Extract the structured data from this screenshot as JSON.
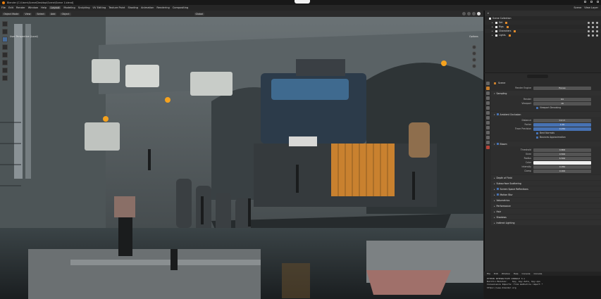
{
  "window": {
    "title": "Blender [C:\\Users\\Scene\\Desktop\\Scene\\Scene 1.blend]"
  },
  "menubar": {
    "items": [
      "File",
      "Edit",
      "Render",
      "Window",
      "Help",
      "Layout",
      "Modeling",
      "Sculpting",
      "UV Editing",
      "Texture Paint",
      "Shading",
      "Animation",
      "Rendering",
      "Compositing"
    ],
    "active": "Layout",
    "scene_label": "Scene",
    "view_layer_label": "View Layer"
  },
  "viewport_header": {
    "mode": "Object Mode",
    "view": "View",
    "select": "Select",
    "add": "Add",
    "object": "Object",
    "orientation": "Global",
    "options": "Options"
  },
  "viewport": {
    "overlay_left": "User Perspective (Local)",
    "overlay_right": "Options"
  },
  "outliner": {
    "rows": [
      {
        "label": "Scene Collection",
        "indent": 0
      },
      {
        "label": "Set",
        "indent": 1
      },
      {
        "label": "Rigs",
        "indent": 1
      },
      {
        "label": "Characters",
        "indent": 1
      },
      {
        "label": "Lights",
        "indent": 1
      }
    ]
  },
  "properties": {
    "header": "Scene",
    "render_engine_label": "Render Engine",
    "render_engine_value": "Eevee",
    "sampling_title": "Sampling",
    "render_label": "Render",
    "render_value": "64",
    "viewport_label": "Viewport",
    "viewport_value": "16",
    "viewport_denoising": "Viewport Denoising",
    "ao_title": "Ambient Occlusion",
    "distance_label": "Distance",
    "distance_value": "0.2 m",
    "factor_label": "Factor",
    "factor_value": "1.00",
    "trace_precision_label": "Trace Precision",
    "trace_precision_value": "0.250",
    "bent_normals": "Bent Normals",
    "bounces_approx": "Bounces Approximation",
    "bloom_title": "Bloom",
    "threshold_label": "Threshold",
    "threshold_value": "0.800",
    "knee_label": "Knee",
    "knee_value": "0.500",
    "radius_label": "Radius",
    "radius_value": "6.500",
    "color_label": "Color",
    "intensity_label": "Intensity",
    "intensity_value": "0.050",
    "clamp_label": "Clamp",
    "clamp_value": "0.000",
    "collapsed_panels": [
      "Depth of Field",
      "Subsurface Scattering",
      "Screen Space Reflections",
      "Motion Blur",
      "Volumetrics",
      "Performance",
      "Hair",
      "Shadows",
      "Indirect Lighting"
    ]
  },
  "console": {
    "tabs": [
      "File",
      "Edit",
      "Window",
      "Help",
      "Console",
      "Console"
    ],
    "lines": [
      "PYTHON INTERACTIVE CONSOLE 3.x",
      "Builtin Modules:    bpy, bpy.data, bpy.ops",
      "Convenience Imports: from mathutils import *",
      "https://www.blender.org"
    ]
  }
}
